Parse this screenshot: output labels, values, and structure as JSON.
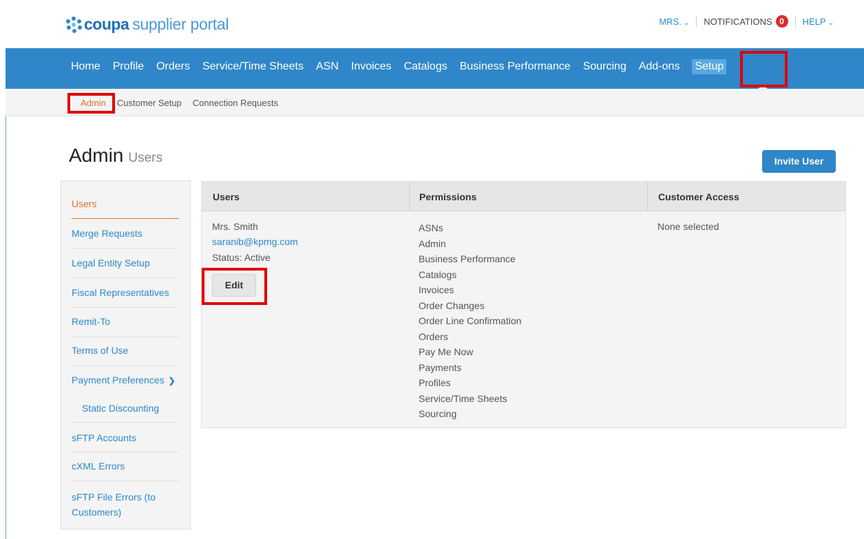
{
  "brand": {
    "name": "coupa",
    "product": "supplier portal"
  },
  "topbar": {
    "user_menu": "MRS.",
    "notifications_label": "NOTIFICATIONS",
    "notifications_count": "0",
    "help_menu": "HELP"
  },
  "main_nav": {
    "items": [
      {
        "label": "Home"
      },
      {
        "label": "Profile"
      },
      {
        "label": "Orders"
      },
      {
        "label": "Service/Time Sheets"
      },
      {
        "label": "ASN"
      },
      {
        "label": "Invoices"
      },
      {
        "label": "Catalogs"
      },
      {
        "label": "Business Performance"
      },
      {
        "label": "Sourcing"
      },
      {
        "label": "Add-ons"
      },
      {
        "label": "Setup"
      }
    ],
    "active": "Setup"
  },
  "sub_nav": {
    "items": [
      {
        "label": "Admin"
      },
      {
        "label": "Customer Setup"
      },
      {
        "label": "Connection Requests"
      }
    ],
    "active": "Admin"
  },
  "page": {
    "title": "Admin",
    "subtitle": "Users",
    "invite_button": "Invite User"
  },
  "side_menu": {
    "items": [
      {
        "label": "Users"
      },
      {
        "label": "Merge Requests"
      },
      {
        "label": "Legal Entity Setup"
      },
      {
        "label": "Fiscal Representatives"
      },
      {
        "label": "Remit-To"
      },
      {
        "label": "Terms of Use"
      },
      {
        "label": "Payment Preferences"
      },
      {
        "label": "Static Discounting"
      },
      {
        "label": "sFTP Accounts"
      },
      {
        "label": "cXML Errors"
      },
      {
        "label": "sFTP File Errors (to Customers)"
      }
    ],
    "active": "Users"
  },
  "users_table": {
    "headers": [
      "Users",
      "Permissions",
      "Customer Access"
    ],
    "rows": [
      {
        "name": "Mrs. Smith",
        "email": "saranib@kpmg.com",
        "status": "Status: Active",
        "edit_label": "Edit",
        "permissions": [
          "ASNs",
          "Admin",
          "Business Performance",
          "Catalogs",
          "Invoices",
          "Order Changes",
          "Order Line Confirmation",
          "Orders",
          "Pay Me Now",
          "Payments",
          "Profiles",
          "Service/Time Sheets",
          "Sourcing"
        ],
        "customer_access": "None selected"
      }
    ]
  },
  "colors": {
    "nav_blue": "#2f86c8",
    "active_orange": "#e8702a",
    "link_blue": "#2b89cc",
    "highlight_red": "#e00000"
  }
}
